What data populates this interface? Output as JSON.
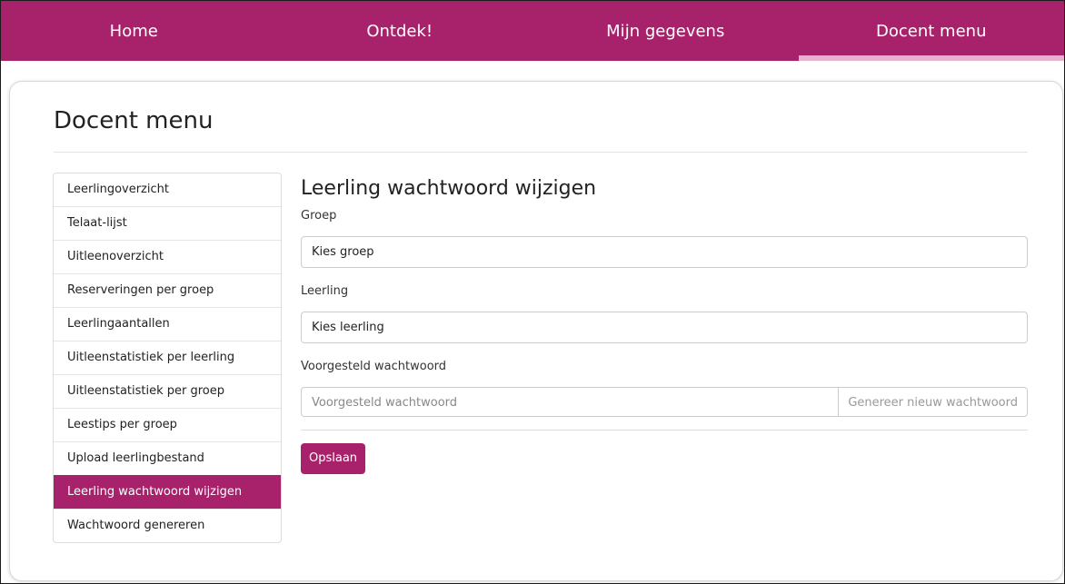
{
  "colors": {
    "brand": "#a7226b",
    "active_tab_indicator": "#e6b3cf"
  },
  "nav": {
    "tabs": [
      {
        "label": "Home"
      },
      {
        "label": "Ontdek!"
      },
      {
        "label": "Mijn gegevens"
      },
      {
        "label": "Docent menu",
        "active": true
      }
    ]
  },
  "page": {
    "title": "Docent menu"
  },
  "sidebar": {
    "items": [
      {
        "label": "Leerlingoverzicht"
      },
      {
        "label": "Telaat-lijst"
      },
      {
        "label": "Uitleenoverzicht"
      },
      {
        "label": "Reserveringen per groep"
      },
      {
        "label": "Leerlingaantallen"
      },
      {
        "label": "Uitleenstatistiek per leerling"
      },
      {
        "label": "Uitleenstatistiek per groep"
      },
      {
        "label": "Leestips per groep"
      },
      {
        "label": "Upload leerlingbestand"
      },
      {
        "label": "Leerling wachtwoord wijzigen",
        "active": true
      },
      {
        "label": "Wachtwoord genereren"
      }
    ]
  },
  "form": {
    "title": "Leerling wachtwoord wijzigen",
    "group": {
      "label": "Groep",
      "value": "Kies groep"
    },
    "student": {
      "label": "Leerling",
      "value": "Kies leerling"
    },
    "password": {
      "label": "Voorgesteld wachtwoord",
      "placeholder": "Voorgesteld wachtwoord",
      "generate_label": "Genereer nieuw wachtwoord"
    },
    "save_label": "Opslaan"
  }
}
